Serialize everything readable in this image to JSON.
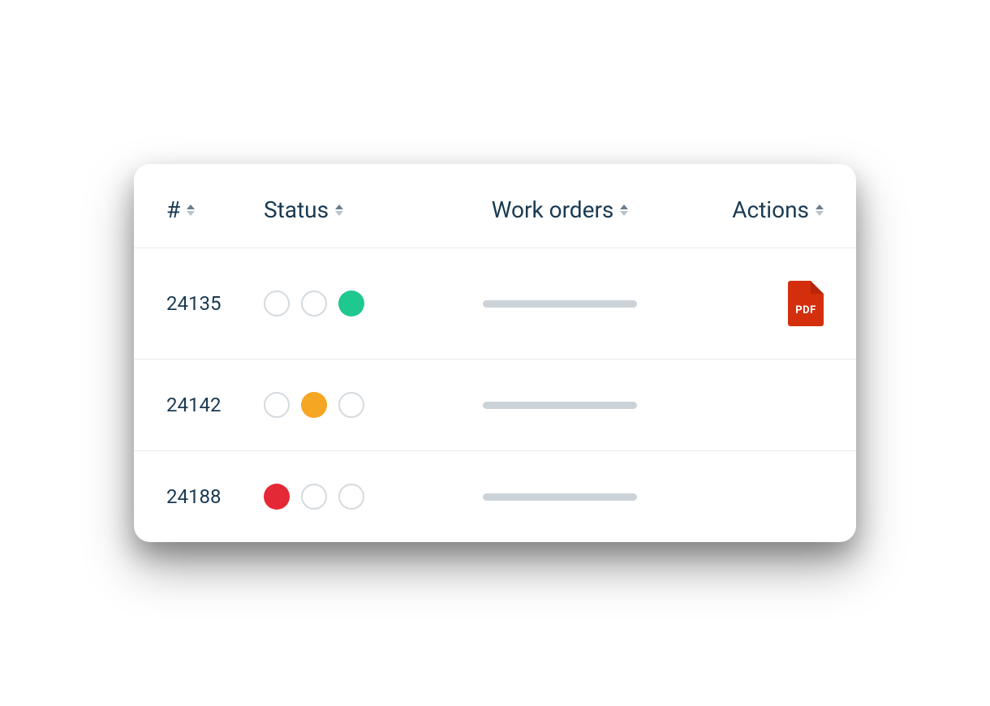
{
  "table": {
    "headers": {
      "number": "#",
      "status": "Status",
      "work_orders": "Work orders",
      "actions": "Actions"
    },
    "rows": [
      {
        "id": "24135",
        "status_active": 2,
        "has_pdf": true
      },
      {
        "id": "24142",
        "status_active": 1,
        "has_pdf": false
      },
      {
        "id": "24188",
        "status_active": 0,
        "has_pdf": false
      }
    ]
  },
  "icons": {
    "pdf_label": "PDF"
  },
  "colors": {
    "text": "#1a3a52",
    "green": "#1fc88f",
    "orange": "#f5a623",
    "red": "#e52836",
    "pdf": "#d32f0c"
  }
}
